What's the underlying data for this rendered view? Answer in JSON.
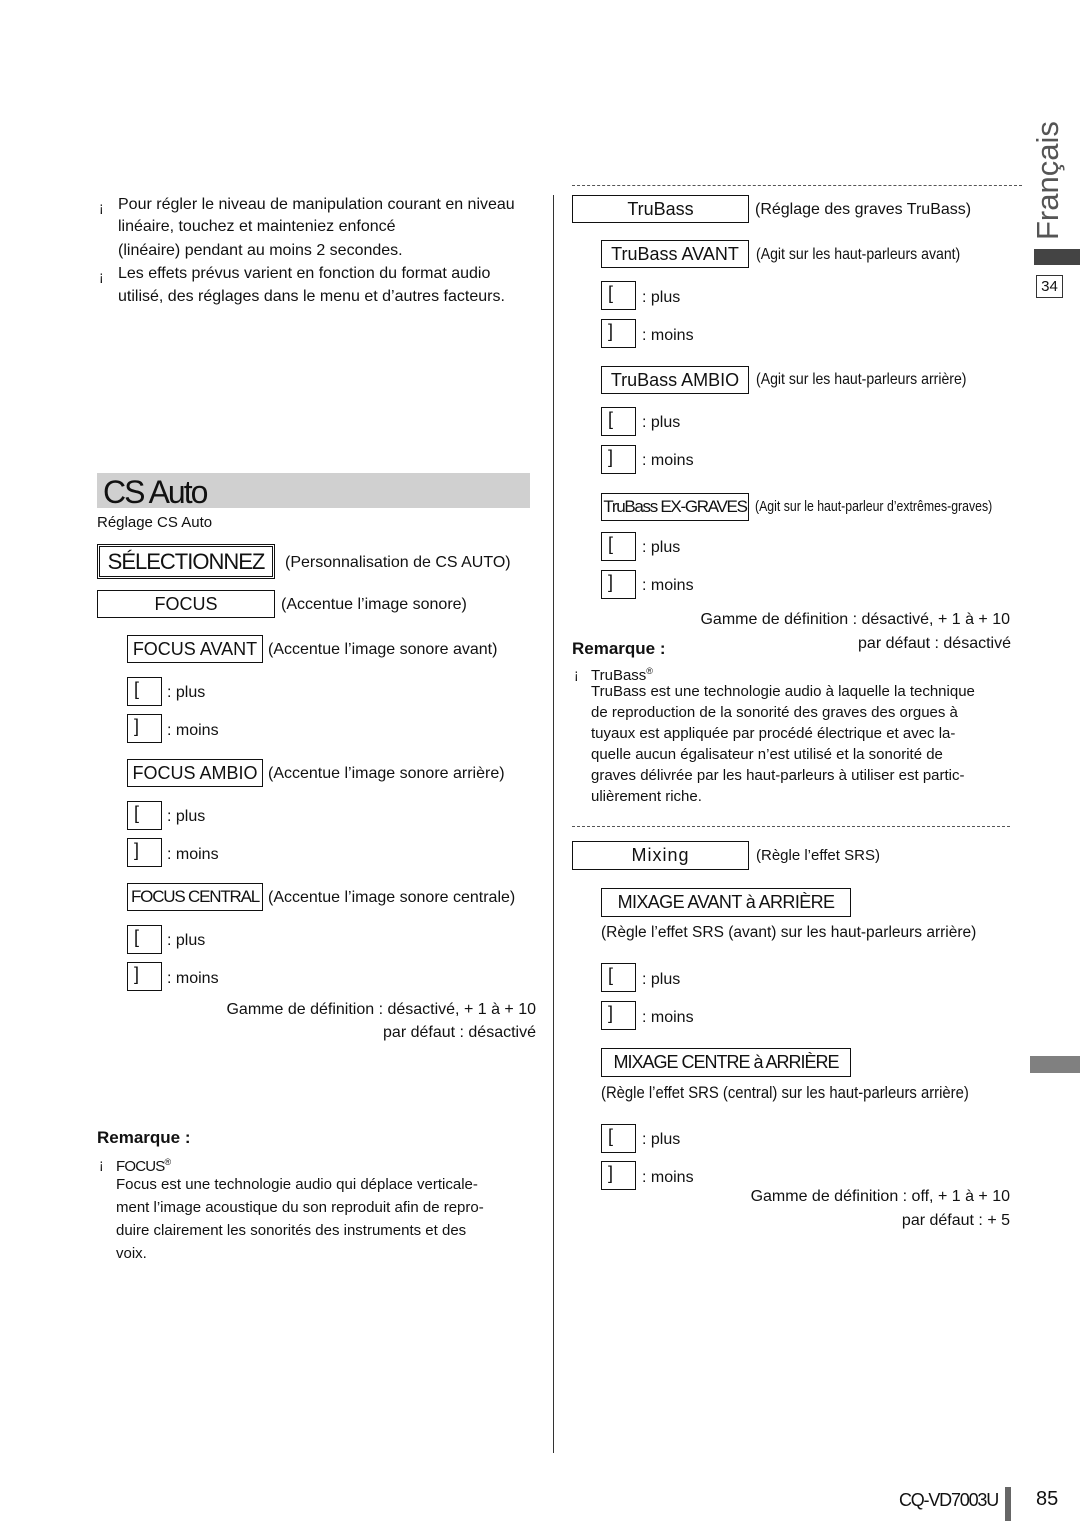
{
  "intro": {
    "bullet": "¡",
    "lines": [
      "Pour régler le niveau de manipulation courant en niveau",
      "linéaire, touchez et mainteniez enfoncé",
      "(linéaire) pendant au moins 2 secondes.",
      "Les effets prévus varient en fonction du format audio",
      "utilisé, des réglages dans le menu et d’autres facteurs."
    ]
  },
  "section": {
    "title": "CS Auto",
    "subtitle": "Réglage CS Auto"
  },
  "left": {
    "select": {
      "label": "SÉLECTIONNEZ",
      "desc": "(Personnalisation de CS AUTO)"
    },
    "focus": {
      "label": "FOCUS",
      "desc": "(Accentue l’image sonore)"
    },
    "items": [
      {
        "label": "FOCUS AVANT",
        "desc": "(Accentue l’image sonore avant)"
      },
      {
        "label": "FOCUS AMBIO",
        "desc": "(Accentue l’image sonore arrière)"
      },
      {
        "label": "FOCUS CENTRAL",
        "desc": "(Accentue l’image sonore centrale)"
      }
    ],
    "range": "Gamme de définition : désactivé, + 1 à + 10",
    "default": "par défaut : désactivé",
    "remark_title": "Remarque :",
    "remark_item": "FOCUS",
    "remark_sup": "®",
    "remark_lines": [
      "Focus est une technologie audio qui déplace verticale-",
      "ment l’image acoustique du son reproduit afin de repro-",
      "duire clairement les sonorités des instruments et des",
      "voix."
    ]
  },
  "keys": {
    "plus_key": "[",
    "minus_key": "]",
    "plus": ": plus",
    "minus": ": moins"
  },
  "right": {
    "trubass": {
      "label": "TruBass",
      "desc": "(Réglage des graves TruBass)"
    },
    "items": [
      {
        "label": "TruBass AVANT",
        "desc": "(Agit sur les haut-parleurs avant)"
      },
      {
        "label": "TruBass AMBIO",
        "desc": "(Agit sur les haut-parleurs arrière)"
      },
      {
        "label": "TruBass EX-GRAVES",
        "desc": "(Agit sur le haut-parleur d’extrêmes-graves)"
      }
    ],
    "range": "Gamme de définition : désactivé, + 1 à + 10",
    "default": "par défaut : désactivé",
    "remark_title": "Remarque :",
    "remark_item": "TruBass",
    "remark_sup": "®",
    "remark_lines": [
      "TruBass est une technologie audio à laquelle la technique",
      "de reproduction de la sonorité des graves des orgues à",
      "tuyaux est appliquée par procédé électrique et avec la-",
      "quelle aucun égalisateur n’est utilisé et la sonorité de",
      "graves délivrée par les haut-parleurs à utiliser est partic-",
      "ulièrement riche."
    ],
    "mixing": {
      "label": "Mixing",
      "desc": "(Règle l’effet SRS)"
    },
    "mix_items": [
      {
        "label": "MIXAGE AVANT à ARRIÈRE",
        "desc": "(Règle l’effet SRS (avant) sur les haut-parleurs arrière)"
      },
      {
        "label": "MIXAGE CENTRE à ARRIÈRE",
        "desc": "(Règle l’effet SRS (central) sur les haut-parleurs arrière)"
      }
    ],
    "mix_range": "Gamme de définition : off, + 1 à + 10",
    "mix_default": "par défaut : + 5"
  },
  "side": {
    "language": "Français",
    "section_number": "34"
  },
  "footer": {
    "model": "CQ-VD7003U",
    "page": "85"
  },
  "colors": {
    "heading_bg": "#d0d0d0",
    "tab_dark": "#444444",
    "tab_gray": "#808080"
  }
}
